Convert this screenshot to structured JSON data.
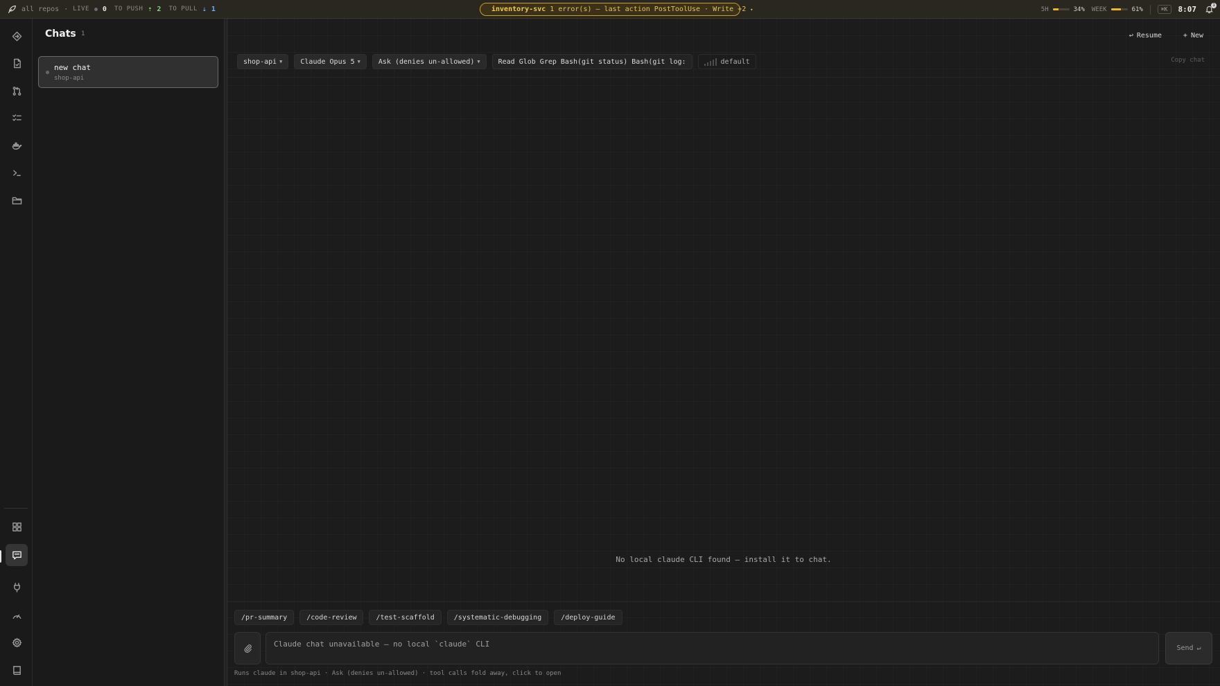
{
  "topbar": {
    "scope": "all repos",
    "live_label": "LIVE",
    "live_count": "0",
    "push_label": "TO PUSH",
    "push_count": "2",
    "pull_label": "TO PULL",
    "pull_count": "1",
    "status": {
      "service": "inventory-svc",
      "message": "1 error(s) — last action PostToolUse · Write",
      "extra": "+2"
    },
    "usage": [
      {
        "label": "5H",
        "percent": 34,
        "percent_text": "34%"
      },
      {
        "label": "WEEK",
        "percent": 61,
        "percent_text": "61%"
      }
    ],
    "shortcut": "⌘K",
    "clock": "8:07",
    "notification_count": "1"
  },
  "rail": {
    "items": [
      {
        "icon": "diamond-icon"
      },
      {
        "icon": "file-icon"
      },
      {
        "icon": "git-pull-request-icon"
      },
      {
        "icon": "checklist-icon"
      },
      {
        "icon": "docker-icon"
      },
      {
        "icon": "terminal-icon"
      },
      {
        "icon": "folder-icon"
      },
      {
        "icon": "grid-icon"
      },
      {
        "icon": "chat-icon",
        "active": true
      },
      {
        "icon": "plug-icon"
      },
      {
        "icon": "gauge-icon"
      },
      {
        "icon": "gear-icon"
      },
      {
        "icon": "book-icon"
      }
    ]
  },
  "chats": {
    "title": "Chats",
    "count": "1",
    "items": [
      {
        "name": "new chat",
        "repo": "shop-api",
        "selected": true
      }
    ]
  },
  "main": {
    "resume_label": "Resume",
    "new_label": "New",
    "toolbar": {
      "repo": "shop-api",
      "model": "Claude Opus 5",
      "permission": "Ask (denies un-allowed)",
      "tools": "Read Glob Grep Bash(git status) Bash(git log:",
      "effort": "default",
      "copy_label": "Copy chat"
    },
    "empty_message": "No local claude CLI found — install it to chat.",
    "commands": [
      "/pr-summary",
      "/code-review",
      "/test-scaffold",
      "/systematic-debugging",
      "/deploy-guide"
    ],
    "compose_placeholder": "Claude chat unavailable — no local `claude` CLI",
    "send_label": "Send",
    "send_hint": "↵",
    "footer": "Runs claude in shop-api · Ask (denies un-allowed) · tool calls fold away, click to open"
  },
  "colors": {
    "accent_warning": "#f0b429",
    "push_green": "#7fd67f",
    "pull_blue": "#6fb0f0"
  }
}
